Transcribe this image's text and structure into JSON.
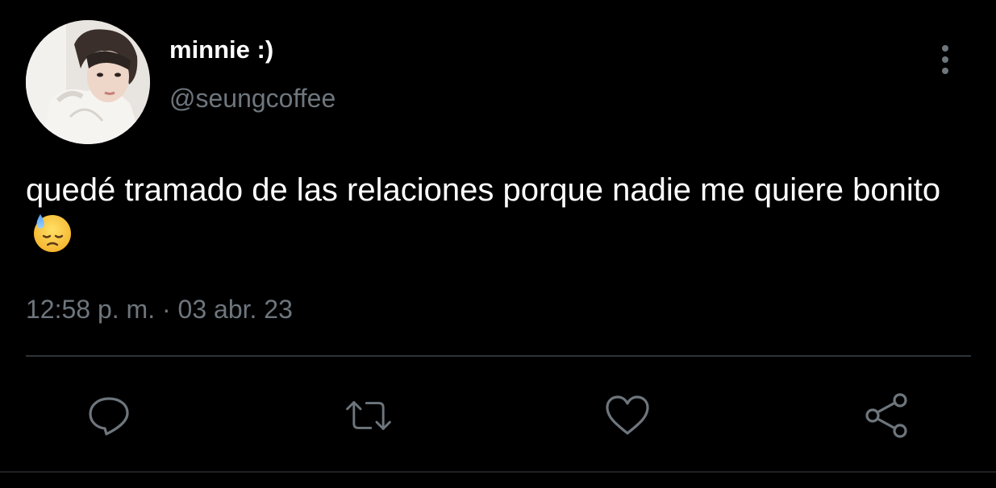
{
  "tweet": {
    "author": {
      "display_name": "minnie :)",
      "handle": "@seungcoffee",
      "avatar": "profile-photo"
    },
    "text": "quedé tramado de las relaciones porque nadie me quiere bonito",
    "emoji": "downcast-face-with-sweat",
    "timestamp": "12:58 p. m. · 03 abr. 23"
  },
  "actions": [
    "reply-icon",
    "retweet-icon",
    "like-icon",
    "share-icon"
  ],
  "colors": {
    "background": "#000000",
    "text_primary": "#ffffff",
    "text_secondary": "#6e767d",
    "divider": "#2f3336"
  }
}
